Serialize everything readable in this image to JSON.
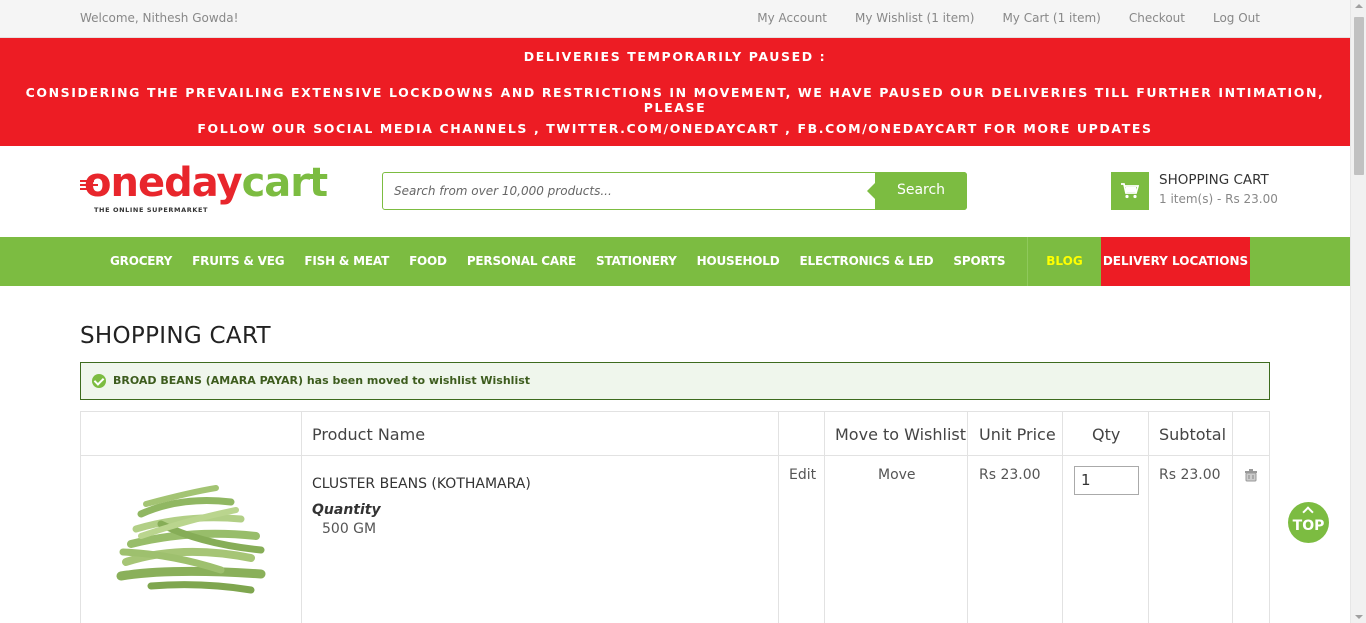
{
  "topbar": {
    "welcome": "Welcome, Nithesh Gowda!",
    "links": [
      "My Account",
      "My Wishlist (1 item)",
      "My Cart (1 item)",
      "Checkout",
      "Log Out"
    ]
  },
  "alert": {
    "line1": "DELIVERIES TEMPORARILY PAUSED :",
    "line2": "CONSIDERING THE PREVAILING EXTENSIVE LOCKDOWNS AND RESTRICTIONS IN MOVEMENT, WE HAVE PAUSED OUR DELIVERIES TILL FURTHER INTIMATION, PLEASE",
    "line3": "FOLLOW OUR SOCIAL MEDIA CHANNELS , TWITTER.COM/ONEDAYCART , FB.COM/ONEDAYCART FOR MORE UPDATES"
  },
  "logo": {
    "part1": "oneday",
    "part2": "cart",
    "tagline": "THE ONLINE SUPERMARKET"
  },
  "search": {
    "placeholder": "Search from over 10,000 products...",
    "button": "Search"
  },
  "minicart": {
    "title": "SHOPPING CART",
    "summary": "1 item(s) - Rs 23.00",
    "icon": "cart-icon"
  },
  "nav": {
    "items": [
      "GROCERY",
      "FRUITS & VEG",
      "FISH & MEAT",
      "FOOD",
      "PERSONAL CARE",
      "STATIONERY",
      "HOUSEHOLD",
      "ELECTRONICS & LED",
      "SPORTS"
    ],
    "blog": "BLOG",
    "delivery": "DELIVERY LOCATIONS"
  },
  "page": {
    "title": "SHOPPING CART",
    "success_message": "BROAD BEANS (AMARA PAYAR) has been moved to wishlist Wishlist"
  },
  "cart_table": {
    "headers": {
      "product": "Product Name",
      "wishlist": "Move to Wishlist",
      "unit_price": "Unit Price",
      "qty": "Qty",
      "subtotal": "Subtotal"
    },
    "rows": [
      {
        "name": "CLUSTER BEANS (KOTHAMARA)",
        "option_label": "Quantity",
        "option_value": "500 GM",
        "edit": "Edit",
        "move": "Move",
        "unit_price": "Rs 23.00",
        "qty": "1",
        "subtotal": "Rs 23.00"
      }
    ]
  },
  "to_top": "TOP",
  "colors": {
    "green": "#7cbc41",
    "red": "#ed1c24",
    "blog_yellow": "#ffff00"
  }
}
